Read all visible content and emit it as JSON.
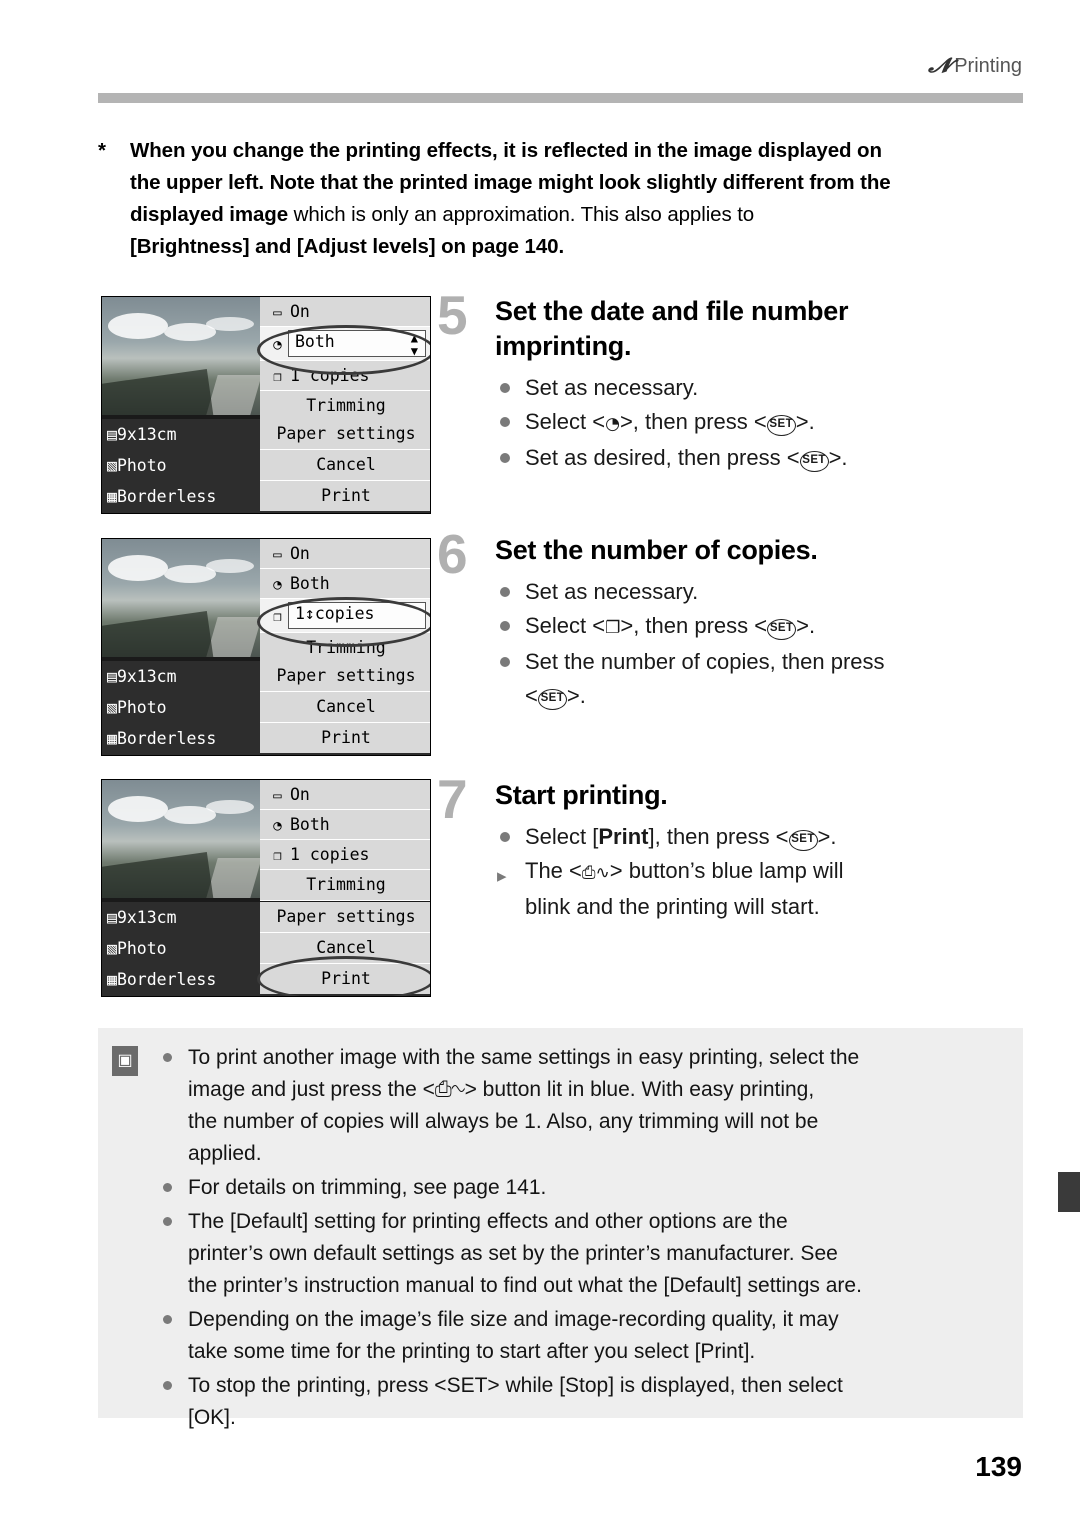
{
  "header": {
    "icon": "camera-printing-icon",
    "label": "Printing"
  },
  "intro": {
    "star": "*",
    "line1": "When you change the printing effects, it is reflected in the image displayed on",
    "line2": "the upper left. Note that the printed image might look slightly different from the",
    "line3_bold": "displayed image",
    "line3_rest": " which is only an approximation. This also applies to",
    "line4": "[Brightness] and [Adjust levels] on page 140."
  },
  "screens": [
    {
      "id": "screen-date-file-number",
      "rows": [
        {
          "icon": "▭",
          "value": "On"
        },
        {
          "icon": "◔",
          "value": "Both",
          "highlight": true,
          "spinner": true
        },
        {
          "icon": "❐",
          "value": "1  copies"
        }
      ],
      "buttons": [
        "Trimming",
        "Paper settings",
        "Cancel",
        "Print"
      ],
      "left_info": [
        {
          "icon": "▤",
          "label": "9x13cm"
        },
        {
          "icon": "▧",
          "label": "Photo"
        },
        {
          "icon": "▦",
          "label": "Borderless"
        }
      ],
      "highlight_target": "date-file-number-row"
    },
    {
      "id": "screen-copies",
      "rows": [
        {
          "icon": "▭",
          "value": "On"
        },
        {
          "icon": "◔",
          "value": "Both"
        },
        {
          "icon": "❐",
          "value": "1↕copies",
          "boxed": true
        }
      ],
      "buttons": [
        "Trimming",
        "Paper settings",
        "Cancel",
        "Print"
      ],
      "left_info": [
        {
          "icon": "▤",
          "label": "9x13cm"
        },
        {
          "icon": "▧",
          "label": "Photo"
        },
        {
          "icon": "▦",
          "label": "Borderless"
        }
      ],
      "highlight_target": "copies-row"
    },
    {
      "id": "screen-print",
      "rows": [
        {
          "icon": "▭",
          "value": "On"
        },
        {
          "icon": "◔",
          "value": "Both"
        },
        {
          "icon": "❐",
          "value": "1  copies"
        }
      ],
      "buttons": [
        "Trimming",
        "Paper settings",
        "Cancel",
        "Print"
      ],
      "left_info": [
        {
          "icon": "▤",
          "label": "9x13cm"
        },
        {
          "icon": "▧",
          "label": "Photo"
        },
        {
          "icon": "▦",
          "label": "Borderless"
        }
      ],
      "highlight_target": "print-button"
    }
  ],
  "steps": [
    {
      "number": "5",
      "title_line1": "Set the date and file number",
      "title_line2": "imprinting.",
      "bullets": [
        {
          "type": "dot",
          "pre": "Set as necessary.",
          "post": ""
        },
        {
          "type": "dot",
          "pre": "Select <",
          "glyph": "◔",
          "mid": ">, then press <",
          "key": "SET",
          "post": ">."
        },
        {
          "type": "dot",
          "pre": "Set as desired, then press <",
          "key": "SET",
          "post": ">."
        }
      ]
    },
    {
      "number": "6",
      "title_line1": "Set the number of copies.",
      "title_line2": "",
      "bullets": [
        {
          "type": "dot",
          "pre": "Set as necessary.",
          "post": ""
        },
        {
          "type": "dot",
          "pre": "Select <",
          "glyph": "❐",
          "mid": ">, then press <",
          "key": "SET",
          "post": ">."
        },
        {
          "type": "dot",
          "pre": "Set the number of copies, then press",
          "post": ""
        },
        {
          "type": "cont",
          "pre": "<",
          "key": "SET",
          "post": ">."
        }
      ]
    },
    {
      "number": "7",
      "title_line1": "Start printing.",
      "title_line2": "",
      "bullets": [
        {
          "type": "dot",
          "pre": "Select [",
          "bold": "Print",
          "mid": "], then press <",
          "key": "SET",
          "post": ">."
        },
        {
          "type": "arrow",
          "pre": "The <",
          "glyph": "⎙∿",
          "mid": "> button’s blue lamp will",
          "post": ""
        },
        {
          "type": "cont",
          "pre": "blink and the printing will start.",
          "post": ""
        }
      ]
    }
  ],
  "notes": {
    "icon": "note-icon",
    "items": [
      {
        "lines": [
          "To print another image with the same settings in easy printing, select the",
          "image and just press the <⎙∿> button lit in blue. With easy printing,",
          "the number of copies will always be 1. Also, any trimming will not be",
          "applied."
        ]
      },
      {
        "lines": [
          "For details on trimming, see page 141."
        ]
      },
      {
        "lines": [
          "The [Default] setting for printing effects and other options are the",
          "printer’s own default settings as set by the printer’s manufacturer. See",
          "the printer’s instruction manual to find out what the [Default] settings are."
        ]
      },
      {
        "lines": [
          "Depending on the image’s file size and image-recording quality, it may",
          "take some time for the printing to start after you select [Print]."
        ]
      },
      {
        "lines": [
          "To stop the printing, press <SET> while [Stop] is displayed, then select",
          "[OK]."
        ]
      }
    ]
  },
  "footer": {
    "page_number": "139"
  }
}
